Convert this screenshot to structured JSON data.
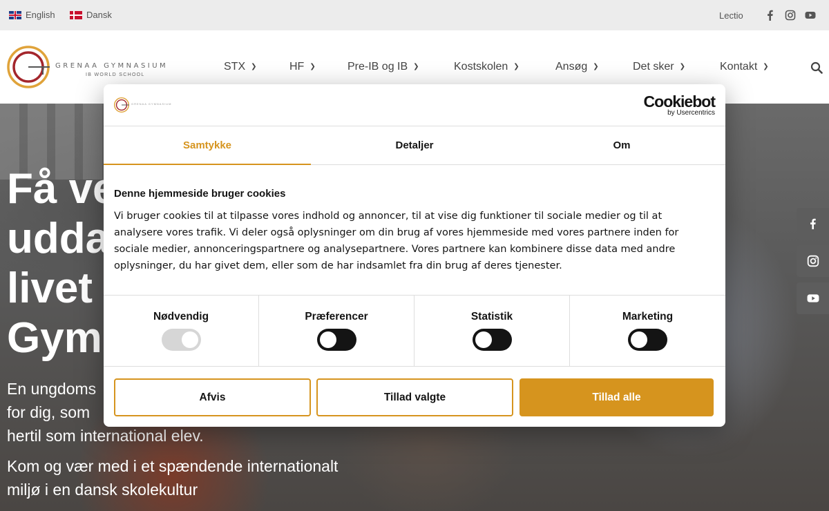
{
  "topbar": {
    "languages": [
      {
        "label": "English",
        "flag": "uk-flag"
      },
      {
        "label": "Dansk",
        "flag": "danish-flag"
      }
    ],
    "lectio": "Lectio",
    "social_icons": [
      "facebook-icon",
      "instagram-icon",
      "youtube-icon"
    ]
  },
  "header": {
    "logo_name": "GRENAA GYMNASIUM",
    "logo_sub": "IB WORLD SCHOOL",
    "nav": [
      {
        "label": "STX"
      },
      {
        "label": "HF"
      },
      {
        "label": "Pre-IB og IB"
      },
      {
        "label": "Kostskolen"
      },
      {
        "label": "Ansøg"
      },
      {
        "label": "Det sker"
      },
      {
        "label": "Kontakt"
      }
    ],
    "search_icon": "search-icon"
  },
  "hero": {
    "title_lines": [
      "Få ve",
      "udda",
      "livet",
      "Gym"
    ],
    "para1_lines": [
      "En ungdoms",
      "for dig, som",
      "hertil som international elev."
    ],
    "para2_lines": [
      "Kom og vær med i et spændende internationalt",
      "miljø i en dansk skolekultur"
    ]
  },
  "cookie_dialog": {
    "brand": "Cookiebot",
    "brand_by": "by Usercentrics",
    "tabs": [
      {
        "label": "Samtykke",
        "active": true
      },
      {
        "label": "Detaljer",
        "active": false
      },
      {
        "label": "Om",
        "active": false
      }
    ],
    "heading": "Denne hjemmeside bruger cookies",
    "text_lines": [
      "Vi bruger cookies til at tilpasse vores indhold og annoncer, til at vise dig funktioner til sociale medier og til at",
      "analysere vores trafik. Vi deler også oplysninger om din brug af vores hjemmeside med vores partnere inden for",
      "sociale medier, annonceringspartnere og analysepartnere. Vores partnere kan kombinere disse data med andre",
      "oplysninger, du har givet dem, eller som de har indsamlet fra din brug af deres tjenester."
    ],
    "categories": [
      {
        "label": "Nødvendig",
        "enabled": true,
        "locked": true
      },
      {
        "label": "Præferencer",
        "enabled": false,
        "locked": false
      },
      {
        "label": "Statistik",
        "enabled": false,
        "locked": false
      },
      {
        "label": "Marketing",
        "enabled": false,
        "locked": false
      }
    ],
    "buttons": {
      "reject": "Afvis",
      "allow_selected": "Tillad valgte",
      "allow_all": "Tillad alle"
    },
    "accent_color": "#d6941e"
  }
}
